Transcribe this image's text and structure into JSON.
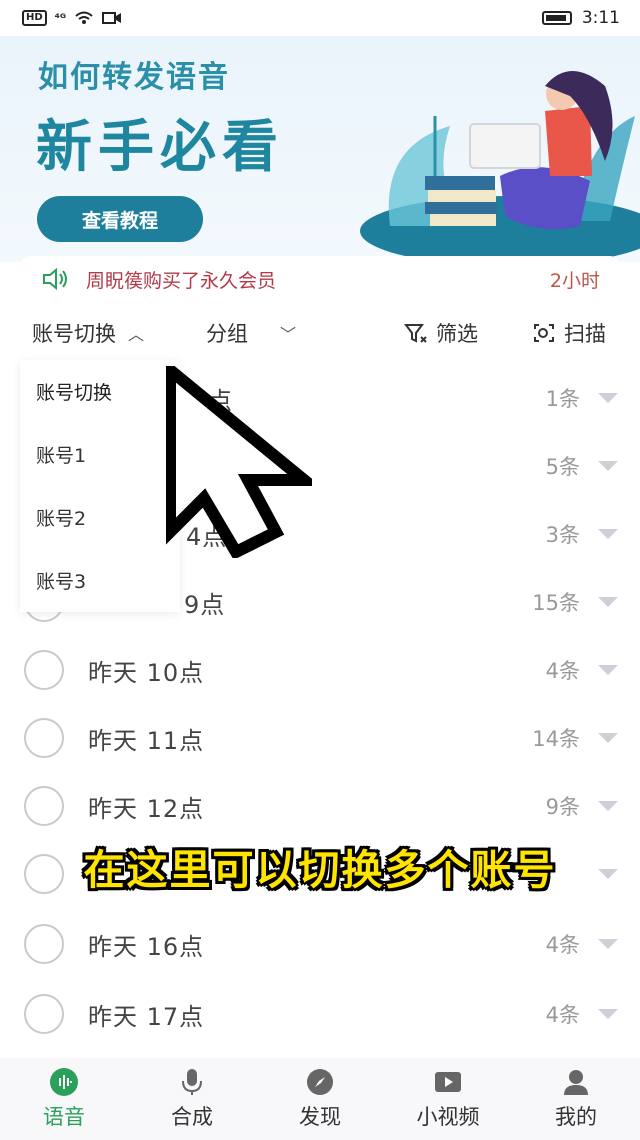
{
  "status_bar": {
    "hd": "HD",
    "signal": "⁴ᴳ",
    "time": "3:11"
  },
  "banner": {
    "subtitle": "如何转发语音",
    "title": "新手必看",
    "button": "查看教程"
  },
  "notice": {
    "text": "周眖篌购买了永久会员",
    "time": "2小时"
  },
  "filters": {
    "account_switch": "账号切换",
    "group": "分组",
    "filter": "筛选",
    "scan": "扫描"
  },
  "dropdown": {
    "options": [
      "账号切换",
      "账号1",
      "账号2",
      "账号3"
    ]
  },
  "list": {
    "rows": [
      {
        "label": "点",
        "count": "1条"
      },
      {
        "label": "",
        "count": "5条"
      },
      {
        "label": "4点",
        "count": "3条"
      },
      {
        "label": "9点",
        "count": "15条"
      },
      {
        "label": "昨天 10点",
        "count": "4条"
      },
      {
        "label": "昨天 11点",
        "count": "14条"
      },
      {
        "label": "昨天 12点",
        "count": "9条"
      },
      {
        "label": "",
        "count": ""
      },
      {
        "label": "昨天 16点",
        "count": "4条"
      },
      {
        "label": "昨天 17点",
        "count": "4条"
      }
    ]
  },
  "caption": "在这里可以切换多个账号",
  "tabs": [
    {
      "label": "语音",
      "icon": "voice-icon",
      "active": true
    },
    {
      "label": "合成",
      "icon": "microphone-icon",
      "active": false
    },
    {
      "label": "发现",
      "icon": "compass-icon",
      "active": false
    },
    {
      "label": "小视频",
      "icon": "video-icon",
      "active": false
    },
    {
      "label": "我的",
      "icon": "profile-icon",
      "active": false
    }
  ],
  "colors": {
    "accent": "#2aa05a",
    "banner_blue": "#1f86a0",
    "notice_red": "#b23a48",
    "caption_yellow": "#ffe400"
  }
}
